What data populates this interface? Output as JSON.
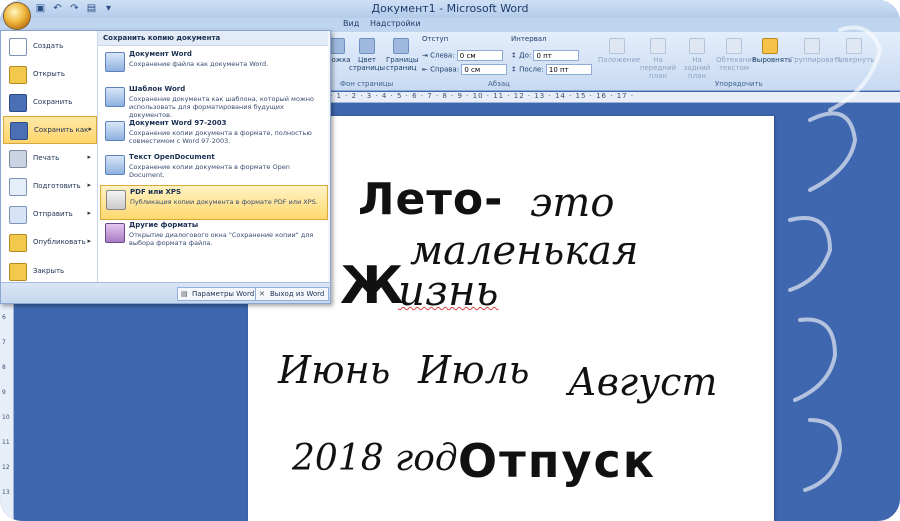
{
  "window": {
    "title": "Документ1 - Microsoft Word"
  },
  "quick_access": {
    "icons": [
      "save-icon",
      "undo-icon",
      "redo-icon",
      "preview-icon",
      "customize-icon"
    ]
  },
  "ribbon_tabs": [
    "Вид",
    "Надстройки"
  ],
  "ribbon": {
    "page_setup_partial": {
      "label_a": "ложка",
      "label_b": "Цвет страницы",
      "label_c": "Границы страниц",
      "group": "Фон страницы"
    },
    "paragraph": {
      "indent_head": "Отступ",
      "spacing_head": "Интервал",
      "left_label": "Слева:",
      "left_value": "0 см",
      "right_label": "Справа:",
      "right_value": "0 см",
      "before_label": "До:",
      "before_value": "0 пт",
      "after_label": "После:",
      "after_value": "10 пт",
      "group": "Абзац"
    },
    "arrange": {
      "buttons": [
        "Положение",
        "На передний план",
        "На задний план",
        "Обтекание текстом",
        "Выровнять",
        "Группировать",
        "Повернуть"
      ],
      "group": "Упорядочить"
    }
  },
  "ruler": {
    "text": "· 1 · 2 · 3 · 4 · 5 · 6 · 7 · 8 · 9 · 10 · 11 · 12 · 13 · 14 · 15 · 16 · 17 ·"
  },
  "vruler": [
    "6",
    "7",
    "8",
    "9",
    "10",
    "11",
    "12",
    "13"
  ],
  "office_menu": {
    "left_items": [
      {
        "label": "Создать",
        "icon": "new-document-icon"
      },
      {
        "label": "Открыть",
        "icon": "open-folder-icon"
      },
      {
        "label": "Сохранить",
        "icon": "save-icon"
      },
      {
        "label": "Сохранить как",
        "icon": "save-as-icon"
      },
      {
        "label": "Печать",
        "icon": "print-icon"
      },
      {
        "label": "Подготовить",
        "icon": "prepare-icon"
      },
      {
        "label": "Отправить",
        "icon": "send-icon"
      },
      {
        "label": "Опубликовать",
        "icon": "publish-icon"
      },
      {
        "label": "Закрыть",
        "icon": "close-folder-icon"
      }
    ],
    "submenu_header": "Сохранить копию документа",
    "submenu_items": [
      {
        "title": "Документ Word",
        "desc": "Сохранение файла как документа Word."
      },
      {
        "title": "Шаблон Word",
        "desc": "Сохранение документа как шаблона, который можно использовать для форматирования будущих документов."
      },
      {
        "title": "Документ Word 97-2003",
        "desc": "Сохранение копии документа в формате, полностью совместимом с Word 97-2003."
      },
      {
        "title": "Текст OpenDocument",
        "desc": "Сохранение копии документа в формате Open Document."
      },
      {
        "title": "PDF или XPS",
        "desc": "Публикация копии документа в формате PDF или XPS."
      },
      {
        "title": "Другие форматы",
        "desc": "Открытие диалогового окна \"Сохранение копии\" для выбора формата файла."
      }
    ],
    "options_button": "Параметры Word",
    "exit_button": "Выход из Word"
  },
  "document": {
    "line1a": "Лето-",
    "line1b": "это",
    "line2": "маленькая",
    "line3a": "Ж",
    "line3b": "изнь",
    "months": [
      "Июнь",
      "Июль",
      "Август"
    ],
    "year": "2018 год",
    "vacation": "Отпуск"
  }
}
